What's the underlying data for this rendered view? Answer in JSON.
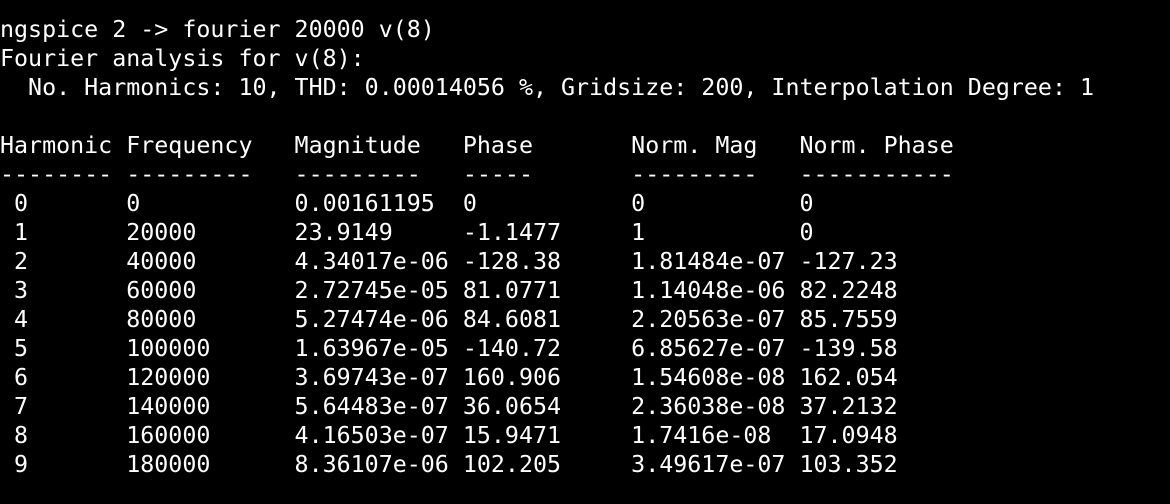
{
  "colors": {
    "background": "#000000",
    "foreground": "#ffffff"
  },
  "terminal": {
    "lines": [
      "ngspice 2 -> fourier 20000 v(8)",
      "Fourier analysis for v(8):",
      "  No. Harmonics: 10, THD: 0.00014056 %, Gridsize: 200, Interpolation Degree: 1",
      "",
      "Harmonic Frequency   Magnitude   Phase       Norm. Mag   Norm. Phase",
      "-------- ---------   ---------   -----       ---------   -----------",
      " 0       0           0.00161195  0           0           0",
      " 1       20000       23.9149     -1.1477     1           0",
      " 2       40000       4.34017e-06 -128.38     1.81484e-07 -127.23",
      " 3       60000       2.72745e-05 81.0771     1.14048e-06 82.2248",
      " 4       80000       5.27474e-06 84.6081     2.20563e-07 85.7559",
      " 5       100000      1.63967e-05 -140.72     6.85627e-07 -139.58",
      " 6       120000      3.69743e-07 160.906     1.54608e-08 162.054",
      " 7       140000      5.64483e-07 36.0654     2.36038e-08 37.2132",
      " 8       160000      4.16503e-07 15.9471     1.7416e-08  17.0948",
      " 9       180000      8.36107e-06 102.205     3.49617e-07 103.352"
    ]
  }
}
